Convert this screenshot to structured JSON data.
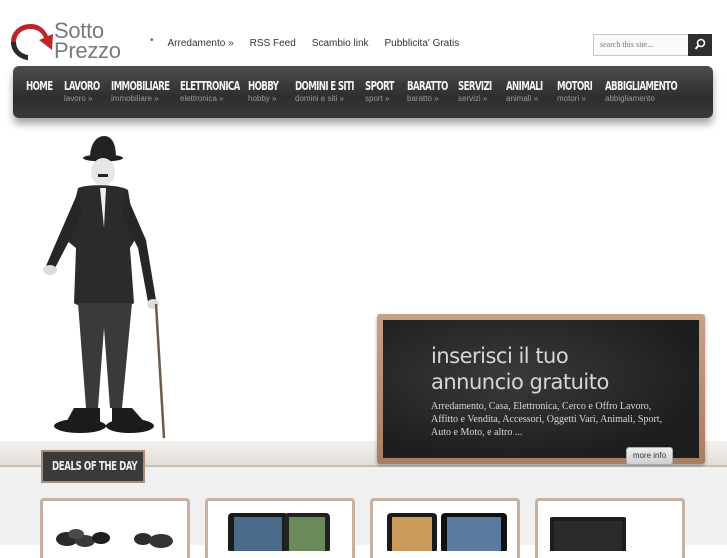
{
  "logo": {
    "line1": "Sotto",
    "line2": "Prezzo"
  },
  "top_links": [
    "Arredamento »",
    "RSS Feed",
    "Scambio link",
    "Pubblicita' Gratis"
  ],
  "search": {
    "placeholder": "search this site..."
  },
  "nav": [
    {
      "label": "HOME",
      "sub": ""
    },
    {
      "label": "LAVORO",
      "sub": "lavoro »"
    },
    {
      "label": "IMMOBILIARE",
      "sub": "immobiliare »"
    },
    {
      "label": "ELETTRONICA",
      "sub": "elettronica »"
    },
    {
      "label": "HOBBY",
      "sub": "hobby »"
    },
    {
      "label": "DOMINI E SITI",
      "sub": "domini e siti »"
    },
    {
      "label": "SPORT",
      "sub": "sport »"
    },
    {
      "label": "BARATTO",
      "sub": "baratto »"
    },
    {
      "label": "SERVIZI",
      "sub": "servizi »"
    },
    {
      "label": "ANIMALI",
      "sub": "animali »"
    },
    {
      "label": "MOTORI",
      "sub": "motori »"
    },
    {
      "label": "ABBIGLIAMENTO",
      "sub": "abbigliamento"
    }
  ],
  "board": {
    "title_line1": "inserisci il tuo",
    "title_line2": "annuncio gratuito",
    "description": "Arredamento, Casa, Elettronica, Cerco e Offro Lavoro, Affitto e Vendita, Accessori, Oggetti Vari, Animali, Sport, Auto e Moto, e altro ...",
    "button": "more info"
  },
  "deals_label": "DEALS OF THE DAY",
  "colors": {
    "nav_bg": "#3a3a3a",
    "frame": "#c9a184",
    "logo_red": "#c0242b"
  }
}
